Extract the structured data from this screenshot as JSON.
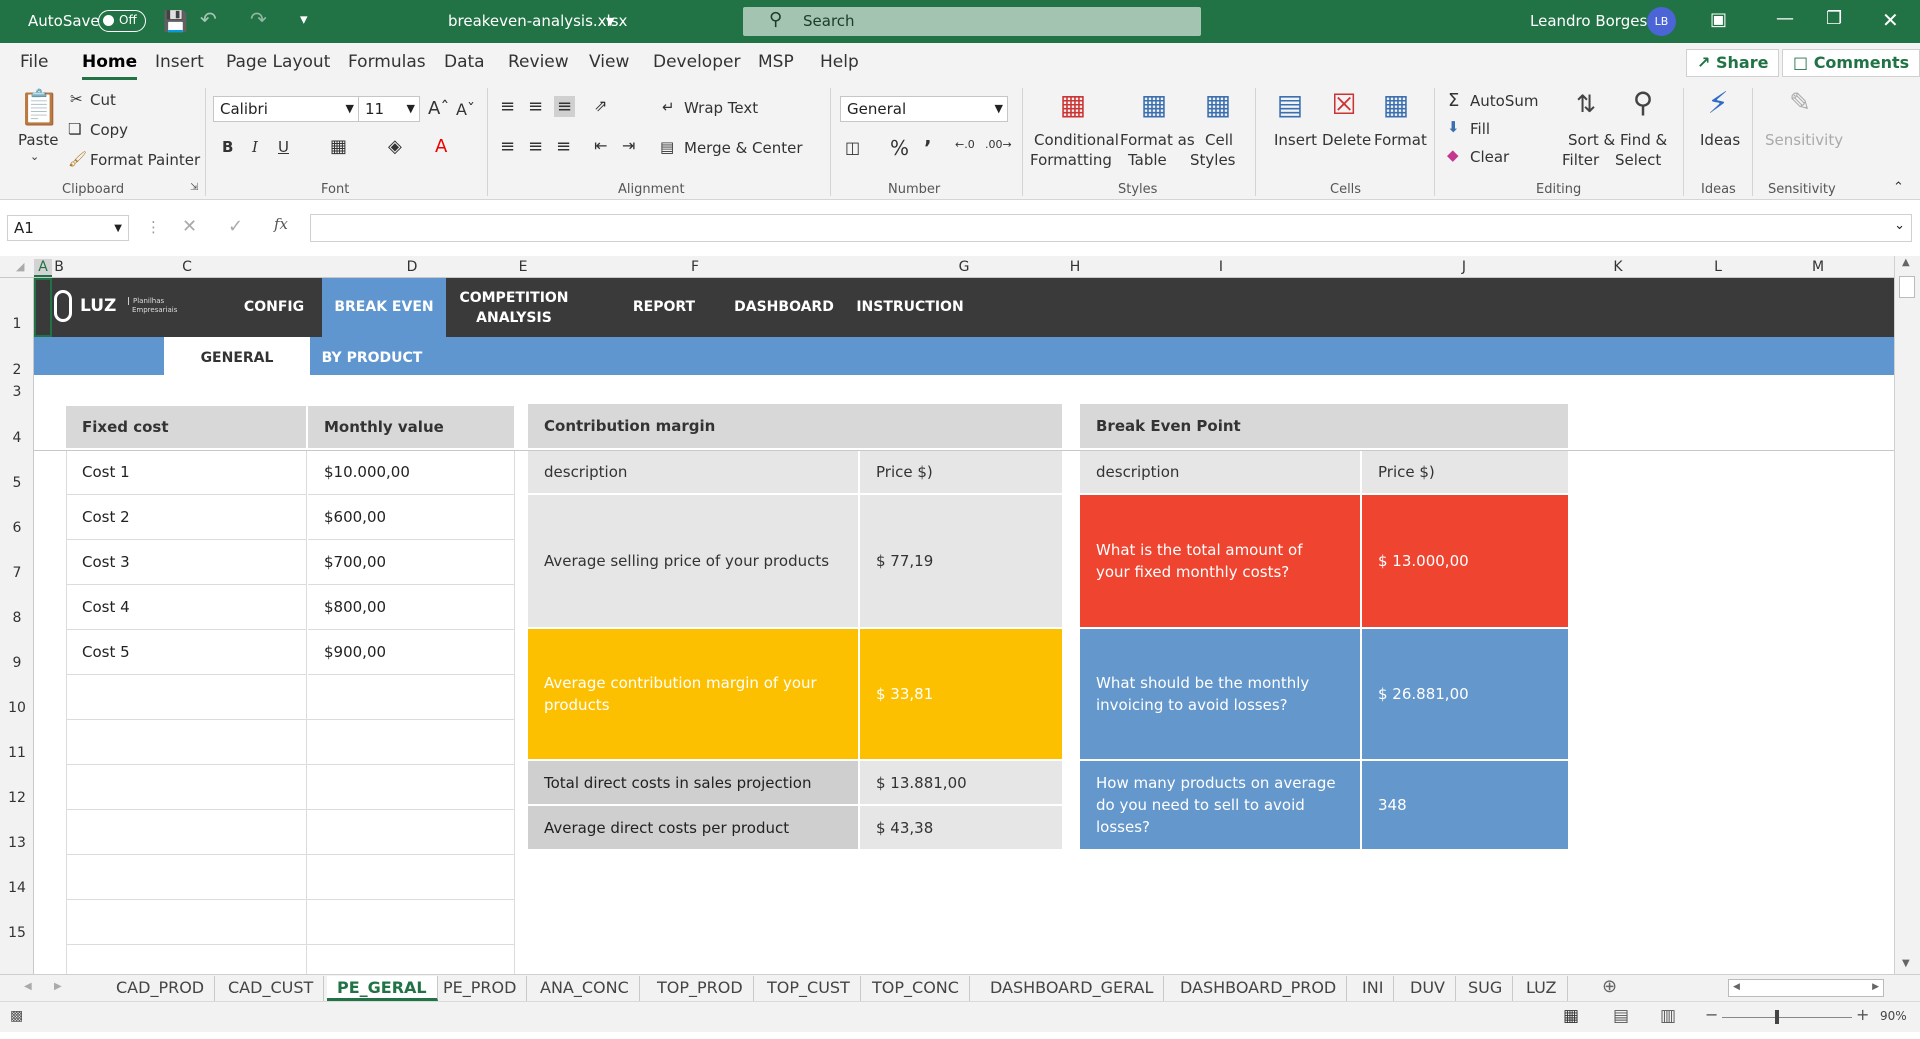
{
  "titlebar": {
    "autosave_label": "AutoSave",
    "autosave_state": "Off",
    "filename": "breakeven-analysis.xlsx",
    "search_placeholder": "Search",
    "user_name": "Leandro Borges",
    "user_initials": "LB",
    "bg_color": "#217346"
  },
  "menu": {
    "tabs": [
      "File",
      "Home",
      "Insert",
      "Page Layout",
      "Formulas",
      "Data",
      "Review",
      "View",
      "Developer",
      "MSP",
      "Help"
    ],
    "active": "Home",
    "share_label": "Share",
    "comments_label": "Comments"
  },
  "ribbon": {
    "clipboard": {
      "paste": "Paste",
      "cut": "Cut",
      "copy": "Copy",
      "format_painter": "Format Painter",
      "group": "Clipboard"
    },
    "font": {
      "name": "Calibri",
      "size": "11",
      "bold": "B",
      "italic": "I",
      "underline": "U",
      "group": "Font"
    },
    "alignment": {
      "wrap": "Wrap Text",
      "merge": "Merge & Center",
      "group": "Alignment"
    },
    "number": {
      "format": "General",
      "group": "Number"
    },
    "styles": {
      "conditional_1": "Conditional",
      "conditional_2": "Formatting",
      "format_table_1": "Format as",
      "format_table_2": "Table",
      "cell_styles_1": "Cell",
      "cell_styles_2": "Styles",
      "group": "Styles"
    },
    "cells": {
      "insert": "Insert",
      "delete": "Delete",
      "format": "Format",
      "group": "Cells"
    },
    "editing": {
      "autosum": "AutoSum",
      "fill": "Fill",
      "clear": "Clear",
      "sort_1": "Sort &",
      "sort_2": "Filter",
      "find_1": "Find &",
      "find_2": "Select",
      "group": "Editing"
    },
    "ideas": {
      "label": "Ideas",
      "group": "Ideas"
    },
    "sensitivity": {
      "label": "Sensitivity",
      "group": "Sensitivity"
    }
  },
  "formula_bar": {
    "name_box": "A1",
    "fx": "fx",
    "content": ""
  },
  "columns": [
    "A",
    "B",
    "C",
    "D",
    "E",
    "F",
    "G",
    "H",
    "I",
    "J",
    "K",
    "L",
    "M"
  ],
  "rows": [
    "1",
    "2",
    "3",
    "4",
    "5",
    "6",
    "7",
    "8",
    "9",
    "10",
    "11",
    "12",
    "13",
    "14",
    "15"
  ],
  "sheet": {
    "logo": "LUZ",
    "logo_sub_1": "Planilhas",
    "logo_sub_2": "Empresariais",
    "nav": [
      "CONFIG",
      "BREAK EVEN",
      "COMPETITION ANALYSIS",
      "REPORT",
      "DASHBOARD",
      "INSTRUCTION"
    ],
    "nav_active": "BREAK EVEN",
    "sub_nav": [
      "GENERAL",
      "BY PRODUCT"
    ],
    "sub_active": "GENERAL",
    "fixed_cost": {
      "header_name": "Fixed cost",
      "header_value": "Monthly value",
      "rows": [
        {
          "name": "Cost 1",
          "value": "$10.000,00"
        },
        {
          "name": "Cost 2",
          "value": "$600,00"
        },
        {
          "name": "Cost 3",
          "value": "$700,00"
        },
        {
          "name": "Cost 4",
          "value": "$800,00"
        },
        {
          "name": "Cost 5",
          "value": "$900,00"
        }
      ]
    },
    "contribution": {
      "title": "Contribution margin",
      "col_desc": "description",
      "col_price": "Price $)",
      "rows": [
        {
          "desc": "Average selling price of your products",
          "price": "$ 77,19"
        },
        {
          "desc": "Average contribution margin of your products",
          "price": "$ 33,81"
        },
        {
          "desc": "Total direct costs in sales projection",
          "price": "$ 13.881,00"
        },
        {
          "desc": "Average direct costs per product",
          "price": "$ 43,38"
        }
      ]
    },
    "breakeven": {
      "title": "Break Even Point",
      "col_desc": "description",
      "col_price": "Price $)",
      "rows": [
        {
          "desc": "What is the total amount of your fixed monthly costs?",
          "price": "$ 13.000,00"
        },
        {
          "desc": "What should be the monthly invoicing to avoid losses?",
          "price": "$ 26.881,00"
        },
        {
          "desc": "How many products on average do you need to sell to avoid losses?",
          "price": "348"
        }
      ]
    },
    "colors": {
      "nav_bg": "#3a3a3a",
      "accent_blue": "#5f96cf",
      "red": "#ef4430",
      "yellow": "#fdc000",
      "blue": "#6497cb"
    }
  },
  "sheet_tabs": [
    "CAD_PROD",
    "CAD_CUST",
    "PE_GERAL",
    "PE_PROD",
    "ANA_CONC",
    "TOP_PROD",
    "TOP_CUST",
    "TOP_CONC",
    "DASHBOARD_GERAL",
    "DASHBOARD_PROD",
    "INI",
    "DUV",
    "SUG",
    "LUZ"
  ],
  "active_sheet": "PE_GERAL",
  "status": {
    "zoom": "90%"
  }
}
